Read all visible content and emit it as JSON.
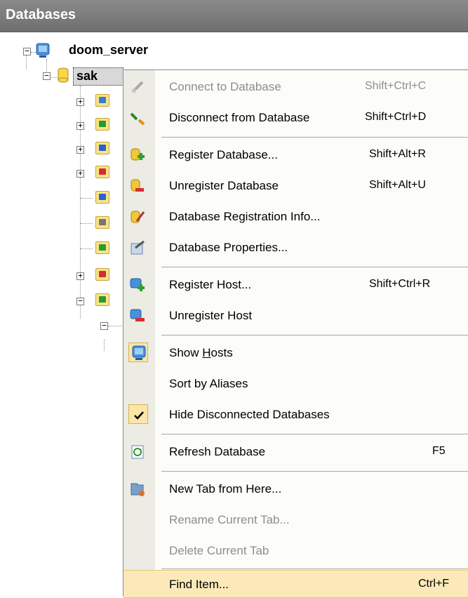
{
  "panel": {
    "title": "Databases"
  },
  "tree": {
    "server_label": "doom_server",
    "database_label": "sak",
    "server_expander": "−",
    "database_expander": "−",
    "child_folders": [
      {
        "icon": "tables-folder-icon",
        "color": "#3a7bd5",
        "expandable": true
      },
      {
        "icon": "relations-folder-icon",
        "color": "#2a9a2a",
        "expandable": true
      },
      {
        "icon": "procedures-folder-icon",
        "color": "#2f5fd0",
        "expandable": true
      },
      {
        "icon": "functions-folder-icon",
        "color": "#d0302f",
        "expandable": true
      },
      {
        "icon": "links-folder-icon",
        "color": "#2f5fd0",
        "expandable": false
      },
      {
        "icon": "grid-folder-icon",
        "color": "#777777",
        "expandable": false
      },
      {
        "icon": "green-folder-icon",
        "color": "#2a9a2a",
        "expandable": false
      },
      {
        "icon": "favorites-folder-icon",
        "color": "#d0302f",
        "expandable": true
      },
      {
        "icon": "filter-folder-icon",
        "color": "#2a9a2a",
        "expandable": true
      }
    ]
  },
  "menu": {
    "items": [
      {
        "label": "Connect to Database",
        "shortcut": "Shift+Ctrl+C",
        "icon": "connect-icon",
        "disabled": true
      },
      {
        "label": "Disconnect from Database",
        "shortcut": "Shift+Ctrl+D",
        "icon": "disconnect-icon",
        "disabled": false
      },
      {
        "label": "Register Database...",
        "shortcut": "Shift+Alt+R",
        "icon": "register-database-icon",
        "disabled": false
      },
      {
        "label": "Unregister Database",
        "shortcut": "Shift+Alt+U",
        "icon": "unregister-database-icon",
        "disabled": false
      },
      {
        "label": "Database Registration Info...",
        "shortcut": "",
        "icon": "registration-info-icon",
        "disabled": false
      },
      {
        "label": "Database Properties...",
        "shortcut": "",
        "icon": "properties-icon",
        "disabled": false
      },
      {
        "label": "Register Host...",
        "shortcut": "Shift+Ctrl+R",
        "icon": "register-host-icon",
        "disabled": false
      },
      {
        "label": "Unregister Host",
        "shortcut": "",
        "icon": "unregister-host-icon",
        "disabled": false
      },
      {
        "label_pre": "Show ",
        "label_u": "H",
        "label_post": "osts",
        "shortcut": "",
        "icon": "show-hosts-icon",
        "disabled": false,
        "checked": true
      },
      {
        "label": "Sort by Aliases",
        "shortcut": "",
        "icon": "",
        "disabled": false
      },
      {
        "label": "Hide Disconnected Databases",
        "shortcut": "",
        "icon": "checkmark-icon",
        "disabled": false,
        "checked": true
      },
      {
        "label": "Refresh Database",
        "shortcut": "F5",
        "icon": "refresh-icon",
        "disabled": false
      },
      {
        "label": "New Tab from Here...",
        "shortcut": "",
        "icon": "new-tab-icon",
        "disabled": false
      },
      {
        "label": "Rename Current Tab...",
        "shortcut": "",
        "icon": "",
        "disabled": true
      },
      {
        "label": "Delete Current Tab",
        "shortcut": "",
        "icon": "",
        "disabled": true
      },
      {
        "label": "Find Item...",
        "shortcut": "Ctrl+F",
        "icon": "",
        "disabled": false,
        "highlighted": true
      }
    ]
  }
}
